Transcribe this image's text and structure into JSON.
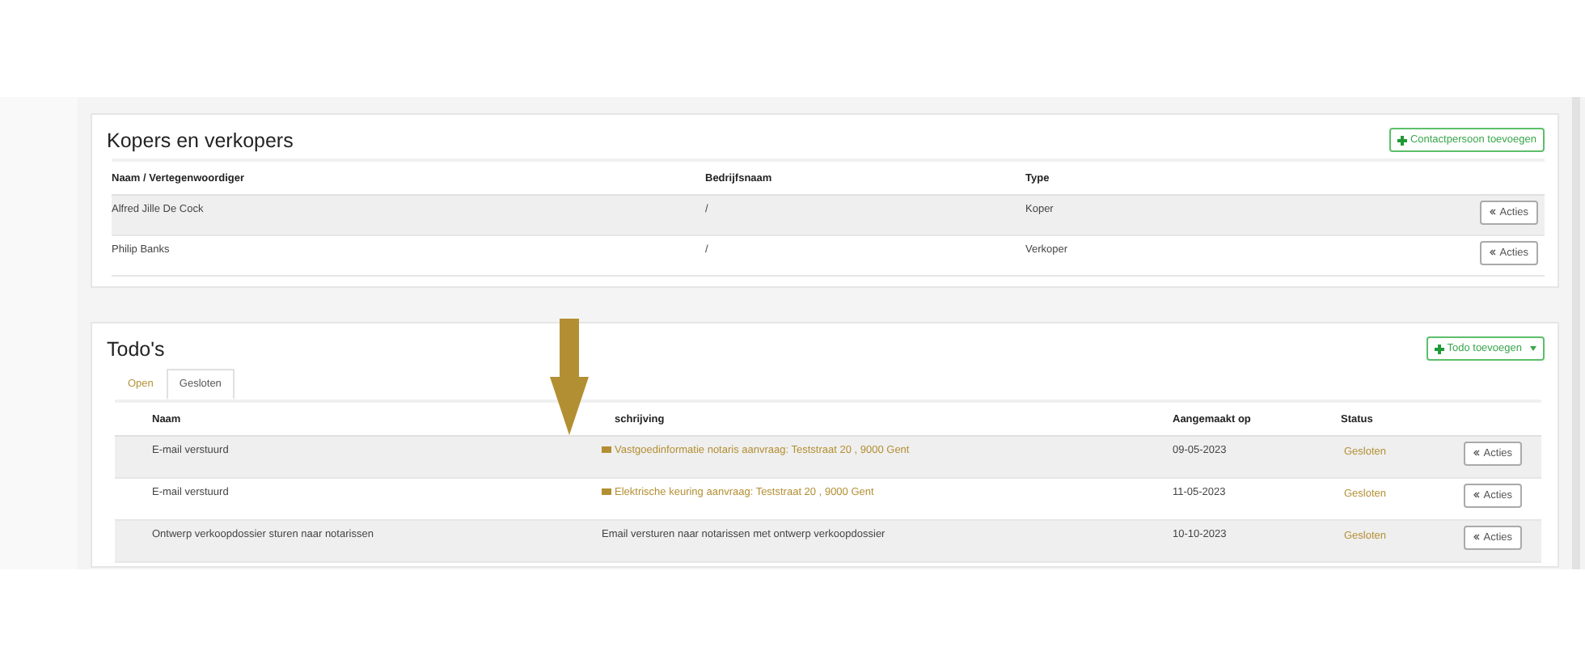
{
  "buyers_sellers": {
    "title": "Kopers en verkopers",
    "add_button": "Contactpersoon toevoegen",
    "columns": [
      "Naam / Vertegenwoordiger",
      "Bedrijfsnaam",
      "Type"
    ],
    "rows": [
      {
        "name": "Alfred Jille De Cock",
        "company": "/",
        "type": "Koper",
        "action": "Acties"
      },
      {
        "name": "Philip Banks",
        "company": "/",
        "type": "Verkoper",
        "action": "Acties"
      }
    ]
  },
  "todos": {
    "title": "Todo's",
    "add_button": "Todo toevoegen",
    "tabs": [
      {
        "label": "Open",
        "selected": false
      },
      {
        "label": "Gesloten",
        "selected": true
      }
    ],
    "columns": [
      "Naam",
      "schrijving",
      "Aangemaakt op",
      "Status"
    ],
    "rows": [
      {
        "name": "E-mail verstuurd",
        "description": "Vastgoedinformatie notaris aanvraag: Teststraat 20 , 9000 Gent",
        "kind": "mail",
        "created": "09-05-2023",
        "status": "Gesloten",
        "action": "Acties"
      },
      {
        "name": "E-mail verstuurd",
        "description": "Elektrische keuring aanvraag: Teststraat 20 , 9000 Gent",
        "kind": "mail",
        "created": "11-05-2023",
        "status": "Gesloten",
        "action": "Acties"
      },
      {
        "name": "Ontwerp verkoopdossier sturen naar notarissen",
        "description": "Email versturen naar notarissen met ontwerp verkoopdossier",
        "kind": "text",
        "created": "10-10-2023",
        "status": "Gesloten",
        "action": "Acties"
      }
    ]
  }
}
